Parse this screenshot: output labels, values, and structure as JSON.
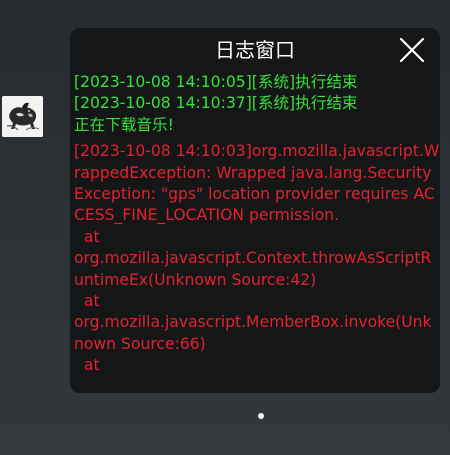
{
  "log_window": {
    "title": "日志窗口",
    "close_icon": "close-icon",
    "colors": {
      "background": "#141618",
      "title": "#ffffff",
      "info": "#37e237",
      "error": "#e4222f"
    },
    "entries": [
      {
        "level": "info",
        "text": "[2023-10-08 14:10:05][系统]执行结束"
      },
      {
        "level": "info",
        "text": "[2023-10-08 14:10:37][系统]执行结束"
      },
      {
        "level": "info",
        "text": "正在下载音乐!"
      },
      {
        "level": "error",
        "text": "[2023-10-08 14:10:03]org.mozilla.javascript.WrappedException: Wrapped java.lang.SecurityException: \"gps\" location provider requires ACCESS_FINE_LOCATION permission.\n  at\norg.mozilla.javascript.Context.throwAsScriptRuntimeEx(Unknown Source:42)\n  at\norg.mozilla.javascript.MemberBox.invoke(Unknown Source:66)\n  at"
      }
    ]
  },
  "floating_avatar": {
    "icon": "wolf-ink-painting-icon"
  },
  "page_indicator": {
    "icon": "page-dot-icon"
  }
}
